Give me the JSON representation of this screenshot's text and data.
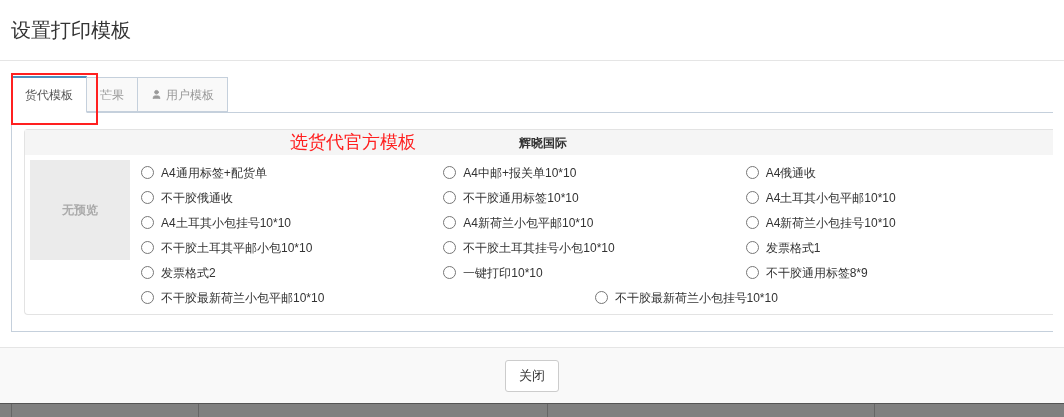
{
  "dialog": {
    "title": "设置打印模板"
  },
  "tabs": [
    {
      "label": "货代模板",
      "selected": true,
      "icon": false
    },
    {
      "label": "芒果",
      "selected": false,
      "icon": false
    },
    {
      "label": "用户模板",
      "selected": false,
      "icon": true
    }
  ],
  "annotation": {
    "text": "选货代官方模板"
  },
  "group": {
    "title": "辉晓国际",
    "preview": "无预览",
    "rows": [
      [
        {
          "label": "A4通用标签+配货单",
          "selected": false
        },
        {
          "label": "A4中邮+报关单10*10",
          "selected": false
        },
        {
          "label": "A4俄通收",
          "selected": false
        }
      ],
      [
        {
          "label": "不干胶俄通收",
          "selected": false
        },
        {
          "label": "不干胶通用标签10*10",
          "selected": false
        },
        {
          "label": "A4土耳其小包平邮10*10",
          "selected": false
        }
      ],
      [
        {
          "label": "A4土耳其小包挂号10*10",
          "selected": false
        },
        {
          "label": "A4新荷兰小包平邮10*10",
          "selected": false
        },
        {
          "label": "A4新荷兰小包挂号10*10",
          "selected": false
        }
      ],
      [
        {
          "label": "不干胶土耳其平邮小包10*10",
          "selected": false
        },
        {
          "label": "不干胶土耳其挂号小包10*10",
          "selected": false
        },
        {
          "label": "发票格式1",
          "selected": false
        }
      ],
      [
        {
          "label": "发票格式2",
          "selected": false
        },
        {
          "label": "一键打印10*10",
          "selected": false
        },
        {
          "label": "不干胶通用标签8*9",
          "selected": false
        }
      ],
      [
        {
          "label": "不干胶最新荷兰小包平邮10*10",
          "selected": false
        },
        {
          "label": "不干胶最新荷兰小包挂号10*10",
          "selected": false
        }
      ]
    ]
  },
  "footer": {
    "close_button": "关闭"
  }
}
